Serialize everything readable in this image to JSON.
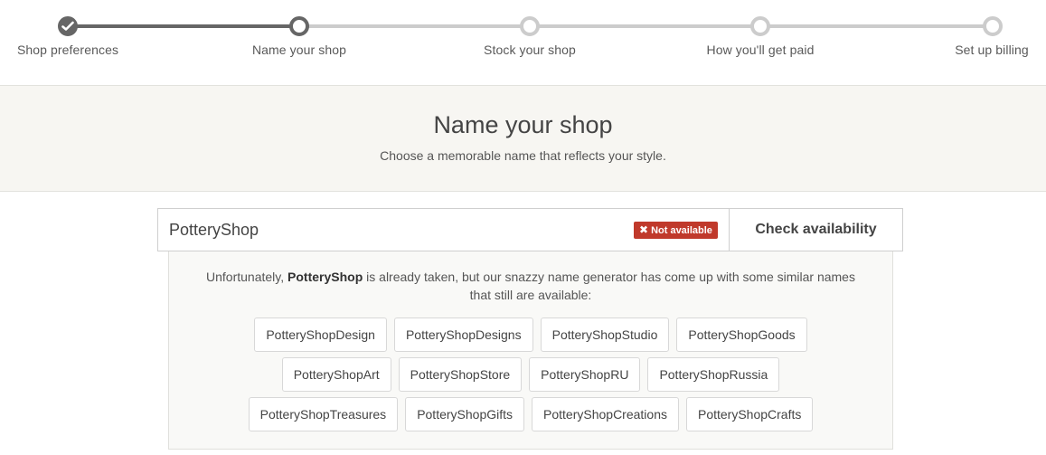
{
  "steps": [
    {
      "label": "Shop preferences",
      "state": "complete"
    },
    {
      "label": "Name your shop",
      "state": "current"
    },
    {
      "label": "Stock your shop",
      "state": "pending"
    },
    {
      "label": "How you'll get paid",
      "state": "pending"
    },
    {
      "label": "Set up billing",
      "state": "pending"
    }
  ],
  "header": {
    "title": "Name your shop",
    "subtitle": "Choose a memorable name that reflects your style."
  },
  "name_field": {
    "value": "PotteryShop",
    "status_badge": "Not available",
    "status_icon": "x-icon"
  },
  "check_button": "Check availability",
  "message": {
    "prefix": "Unfortunately, ",
    "name": "PotteryShop",
    "suffix": " is already taken, but our snazzy name generator has come up with some similar names that still are available:"
  },
  "suggestions": [
    [
      "PotteryShopDesign",
      "PotteryShopDesigns",
      "PotteryShopStudio",
      "PotteryShopGoods"
    ],
    [
      "PotteryShopArt",
      "PotteryShopStore",
      "PotteryShopRU",
      "PotteryShopRussia"
    ],
    [
      "PotteryShopTreasures",
      "PotteryShopGifts",
      "PotteryShopCreations",
      "PotteryShopCrafts"
    ]
  ],
  "colors": {
    "step_done": "#666666",
    "step_pending": "#cccccc",
    "error_badge": "#c0392b",
    "band_background": "#f7f6f2"
  }
}
